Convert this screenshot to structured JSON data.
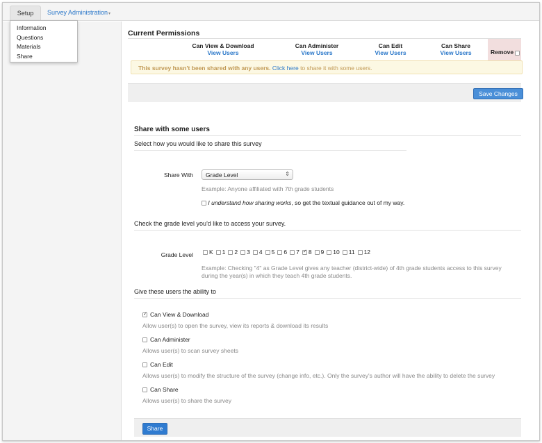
{
  "nav": {
    "setup_tab": "Setup",
    "admin_tab": "Survey Administration",
    "menu": [
      "Information",
      "Questions",
      "Materials",
      "Share"
    ]
  },
  "permissions": {
    "title": "Current Permissions",
    "columns": [
      {
        "title": "Can View & Download",
        "link": "View Users"
      },
      {
        "title": "Can Administer",
        "link": "View Users"
      },
      {
        "title": "Can Edit",
        "link": "View Users"
      },
      {
        "title": "Can Share",
        "link": "View Users"
      }
    ],
    "remove_label": "Remove",
    "alert_text": "This survey hasn't been shared with any users.",
    "alert_link": "Click here",
    "alert_suffix": "to share it with some users.",
    "save_button": "Save Changes"
  },
  "share": {
    "title": "Share with some users",
    "select_prompt": "Select how you would like to share this survey",
    "share_with_label": "Share With",
    "share_with_value": "Grade Level",
    "share_with_hint": "Example: Anyone affiliated with 7th grade students",
    "understand_italic": "I understand how sharing works",
    "understand_rest": ", so get the textual guidance out of my way.",
    "grade_prompt": "Check the grade level you'd like to access your survey.",
    "grade_label": "Grade Level",
    "grades": [
      {
        "label": "K",
        "checked": false
      },
      {
        "label": "1",
        "checked": false
      },
      {
        "label": "2",
        "checked": false
      },
      {
        "label": "3",
        "checked": false
      },
      {
        "label": "4",
        "checked": false
      },
      {
        "label": "5",
        "checked": false
      },
      {
        "label": "6",
        "checked": false
      },
      {
        "label": "7",
        "checked": false
      },
      {
        "label": "8",
        "checked": true
      },
      {
        "label": "9",
        "checked": false
      },
      {
        "label": "10",
        "checked": false
      },
      {
        "label": "11",
        "checked": false
      },
      {
        "label": "12",
        "checked": false
      }
    ],
    "grade_hint_1": "Example: Checking \"4\" as Grade Level gives any teacher (district-wide) of 4th grade students access to this survey",
    "grade_hint_2": "during the year(s) in which they teach 4th grade students.",
    "ability_prompt": "Give these users the ability to",
    "abilities": [
      {
        "label": "Can View & Download",
        "checked": true,
        "desc": "Allow user(s) to open the survey, view its reports & download its results"
      },
      {
        "label": "Can Administer",
        "checked": false,
        "desc": "Allows user(s) to scan survey sheets"
      },
      {
        "label": "Can Edit",
        "checked": false,
        "desc": "Allows user(s) to modify the structure of the survey (change info, etc.). Only the survey's author will have the ability to delete the survey"
      },
      {
        "label": "Can Share",
        "checked": false,
        "desc": "Allows user(s) to share the survey"
      }
    ],
    "share_button": "Share"
  }
}
